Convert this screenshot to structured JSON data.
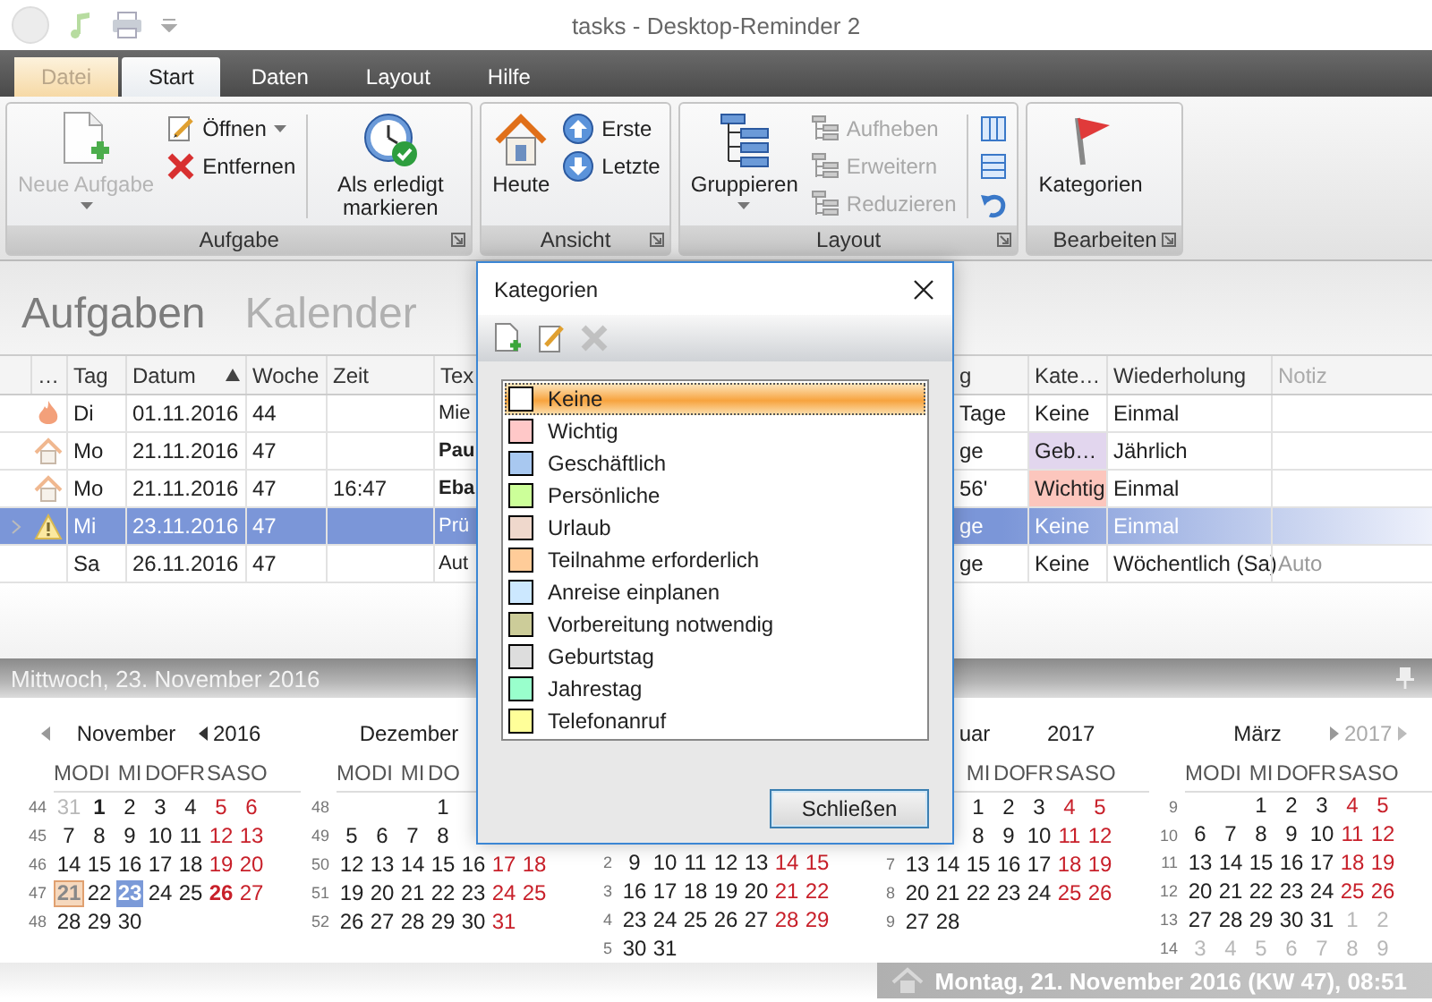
{
  "window": {
    "title": "tasks - Desktop-Reminder 2"
  },
  "ribbon_tabs": [
    {
      "label": "Datei",
      "kind": "file",
      "selected": false
    },
    {
      "label": "Start",
      "kind": "tab",
      "selected": true
    },
    {
      "label": "Daten",
      "kind": "tab",
      "selected": false
    },
    {
      "label": "Layout",
      "kind": "tab",
      "selected": false
    },
    {
      "label": "Hilfe",
      "kind": "tab",
      "selected": false
    }
  ],
  "ribbon": {
    "groups": [
      {
        "label": "Aufgabe",
        "items": [
          {
            "kind": "large",
            "label": "Neue Aufgabe",
            "disabled": true,
            "dropdown": true
          },
          {
            "kind": "small",
            "label": "Öffnen",
            "disabled": false,
            "dropdown": true
          },
          {
            "kind": "small",
            "label": "Entfernen",
            "disabled": false,
            "dropdown": false
          },
          {
            "kind": "large",
            "label": "Als erledigt markieren",
            "disabled": false,
            "dropdown": false
          }
        ]
      },
      {
        "label": "Ansicht",
        "items": [
          {
            "kind": "large",
            "label": "Heute",
            "disabled": false,
            "dropdown": false
          },
          {
            "kind": "small",
            "label": "Erste",
            "disabled": false,
            "dropdown": false
          },
          {
            "kind": "small",
            "label": "Letzte",
            "disabled": false,
            "dropdown": false
          }
        ]
      },
      {
        "label": "Layout",
        "items": [
          {
            "kind": "large",
            "label": "Gruppieren",
            "disabled": false,
            "dropdown": true
          },
          {
            "kind": "small",
            "label": "Aufheben",
            "disabled": true,
            "dropdown": false
          },
          {
            "kind": "small",
            "label": "Erweitern",
            "disabled": true,
            "dropdown": false
          },
          {
            "kind": "small",
            "label": "Reduzieren",
            "disabled": true,
            "dropdown": false
          },
          {
            "kind": "icon",
            "disabled": false,
            "dropdown": false
          },
          {
            "kind": "icon",
            "disabled": false,
            "dropdown": false
          },
          {
            "kind": "icon",
            "disabled": false,
            "dropdown": false
          }
        ]
      },
      {
        "label": "Bearbeiten",
        "items": [
          {
            "kind": "large",
            "label": "Kategorien",
            "disabled": false,
            "dropdown": false
          }
        ]
      }
    ]
  },
  "views": [
    {
      "label": "Aufgaben",
      "selected": true
    },
    {
      "label": "Kalender",
      "selected": false
    }
  ],
  "table": {
    "icon_header": "…",
    "columns": [
      {
        "label": "Tag"
      },
      {
        "label": "Datum",
        "sorted": true
      },
      {
        "label": "Woche"
      },
      {
        "label": "Zeit"
      },
      {
        "label": "Tex"
      },
      {
        "label": "g"
      },
      {
        "label": "Kate…"
      },
      {
        "label": "Wiederholung"
      },
      {
        "label": "Notiz"
      }
    ],
    "rows": [
      {
        "kind": "overdue",
        "selected": false,
        "text_bold": false,
        "color": "#ffffff",
        "cells": [
          "Di",
          "01.11.2016",
          "44",
          "",
          "Mie",
          "Tage",
          "Keine",
          "Einmal",
          ""
        ]
      },
      {
        "kind": "private",
        "selected": false,
        "text_bold": true,
        "color": "#e2d6ee",
        "cells": [
          "Mo",
          "21.11.2016",
          "47",
          "",
          "Pau",
          "ge",
          "Geb…",
          "Jährlich",
          ""
        ]
      },
      {
        "kind": "private",
        "selected": false,
        "text_bold": true,
        "color": "#fcc6bd",
        "cells": [
          "Mo",
          "21.11.2016",
          "47",
          "16:47",
          "Eba",
          "56'",
          "Wichtig",
          "Einmal",
          ""
        ]
      },
      {
        "kind": "warning",
        "selected": true,
        "text_bold": false,
        "cells": [
          "Mi",
          "23.11.2016",
          "47",
          "",
          "Prü",
          "ge",
          "Keine",
          "Einmal",
          ""
        ]
      },
      {
        "kind": "plain",
        "selected": false,
        "text_bold": false,
        "color": "#ffffff",
        "cells": [
          "Sa",
          "26.11.2016",
          "47",
          "",
          "Aut",
          "ge",
          "Keine",
          "Wöchentlich (Sa)",
          "Auto"
        ]
      }
    ]
  },
  "date_bar": {
    "text": "Mittwoch, 23. November 2016"
  },
  "calendar": {
    "months": [
      {
        "name": "November",
        "year": "2016",
        "weekdays": {
          "mon": "MO",
          "tue": "DI",
          "wed": "MI",
          "thu": "DO",
          "fri": "FR",
          "sat": "SA",
          "sun": "SO"
        },
        "weeks": [
          {
            "kind": "week",
            "number": "44",
            "days": {
              "mon": {
                "day": "31",
                "kind": "other"
              },
              "tue": {
                "day": "1",
                "kind": "bold"
              },
              "wed": "2",
              "thu": "3",
              "fri": "4",
              "sat": "5",
              "sun": "6"
            }
          },
          {
            "kind": "week",
            "number": "45",
            "days": {
              "mon": "7",
              "tue": "8",
              "wed": "9",
              "thu": "10",
              "fri": "11",
              "sat": "12",
              "sun": "13"
            }
          },
          {
            "kind": "week",
            "number": "46",
            "days": {
              "mon": "14",
              "tue": "15",
              "wed": "16",
              "thu": "17",
              "fri": "18",
              "sat": "19",
              "sun": "20"
            }
          },
          {
            "kind": "week",
            "number": "47",
            "days": {
              "mon": {
                "day": "21",
                "kind": "today"
              },
              "tue": "22",
              "wed": {
                "day": "23",
                "kind": "selected"
              },
              "thu": "24",
              "fri": "25",
              "sat": {
                "day": "26",
                "kind": "bold"
              },
              "sun": "27"
            }
          },
          {
            "kind": "week",
            "number": "48",
            "days": {
              "mon": "28",
              "tue": "29",
              "wed": "30"
            }
          }
        ]
      },
      {
        "name": "Dezember",
        "weekdays": {
          "mon": "MO",
          "tue": "DI",
          "wed": "MI",
          "thu": "DO"
        },
        "weeks": [
          {
            "kind": "week",
            "number": "48",
            "days": {
              "thu": "1"
            }
          },
          {
            "kind": "week",
            "number": "49",
            "days": {
              "mon": "5",
              "tue": "6",
              "wed": "7",
              "thu": "8"
            }
          },
          {
            "kind": "week",
            "number": "50",
            "days": {
              "mon": "12",
              "tue": "13",
              "wed": "14",
              "thu": "15",
              "fri": "16",
              "sat": "17",
              "sun": "18"
            }
          },
          {
            "kind": "week",
            "number": "51",
            "days": {
              "mon": "19",
              "tue": "20",
              "wed": "21",
              "thu": "22",
              "fri": "23",
              "sat": "24",
              "sun": "25"
            }
          },
          {
            "kind": "week",
            "number": "52",
            "days": {
              "mon": "26",
              "tue": "27",
              "wed": "28",
              "thu": "29",
              "fri": "30",
              "sat": "31"
            }
          }
        ]
      },
      {
        "weeks": [
          {
            "kind": "covered"
          },
          {
            "kind": "covered"
          },
          {
            "kind": "week",
            "number": "2",
            "days": {
              "mon": "9",
              "tue": "10",
              "wed": "11",
              "thu": "12",
              "fri": "13",
              "sat": "14",
              "sun": "15"
            }
          },
          {
            "kind": "week",
            "number": "3",
            "days": {
              "mon": "16",
              "tue": "17",
              "wed": "18",
              "thu": "19",
              "fri": "20",
              "sat": "21",
              "sun": "22"
            }
          },
          {
            "kind": "week",
            "number": "4",
            "days": {
              "mon": "23",
              "tue": "24",
              "wed": "25",
              "thu": "26",
              "fri": "27",
              "sat": "28",
              "sun": "29"
            }
          },
          {
            "kind": "week",
            "number": "5",
            "days": {
              "mon": "30",
              "tue": "31"
            }
          }
        ]
      },
      {
        "name": "uar",
        "year": "2017",
        "weekdays": {
          "wed": "MI",
          "thu": "DO",
          "fri": "FR",
          "sat": "SA",
          "sun": "SO"
        },
        "weeks": [
          {
            "kind": "week",
            "days": {
              "wed": "1",
              "thu": "2",
              "fri": "3",
              "sat": "4",
              "sun": "5"
            }
          },
          {
            "kind": "week",
            "days": {
              "wed": "8",
              "thu": "9",
              "fri": "10",
              "sat": "11",
              "sun": "12"
            }
          },
          {
            "kind": "week",
            "number": "7",
            "days": {
              "mon": "13",
              "tue": "14",
              "wed": "15",
              "thu": "16",
              "fri": "17",
              "sat": "18",
              "sun": "19"
            }
          },
          {
            "kind": "week",
            "number": "8",
            "days": {
              "mon": "20",
              "tue": "21",
              "wed": "22",
              "thu": "23",
              "fri": "24",
              "sat": "25",
              "sun": "26"
            }
          },
          {
            "kind": "week",
            "number": "9",
            "days": {
              "mon": "27",
              "tue": "28"
            }
          }
        ]
      },
      {
        "name": "März",
        "year": "2017",
        "weekdays": {
          "mon": "MO",
          "tue": "DI",
          "wed": "MI",
          "thu": "DO",
          "fri": "FR",
          "sat": "SA",
          "sun": "SO"
        },
        "weeks": [
          {
            "kind": "week",
            "number": "9",
            "days": {
              "wed": "1",
              "thu": "2",
              "fri": "3",
              "sat": "4",
              "sun": "5"
            }
          },
          {
            "kind": "week",
            "number": "10",
            "days": {
              "mon": "6",
              "tue": "7",
              "wed": "8",
              "thu": "9",
              "fri": "10",
              "sat": "11",
              "sun": "12"
            }
          },
          {
            "kind": "week",
            "number": "11",
            "days": {
              "mon": "13",
              "tue": "14",
              "wed": "15",
              "thu": "16",
              "fri": "17",
              "sat": "18",
              "sun": "19"
            }
          },
          {
            "kind": "week",
            "number": "12",
            "days": {
              "mon": "20",
              "tue": "21",
              "wed": "22",
              "thu": "23",
              "fri": "24",
              "sat": "25",
              "sun": "26"
            }
          },
          {
            "kind": "week",
            "number": "13",
            "days": {
              "mon": "27",
              "tue": "28",
              "wed": "29",
              "thu": "30",
              "fri": "31",
              "sat": {
                "day": "1",
                "kind": "other"
              },
              "sun": {
                "day": "2",
                "kind": "other"
              }
            }
          },
          {
            "kind": "week",
            "number": "14",
            "days": {
              "mon": {
                "day": "3",
                "kind": "other"
              },
              "tue": {
                "day": "4",
                "kind": "other"
              },
              "wed": {
                "day": "5",
                "kind": "other"
              },
              "thu": {
                "day": "6",
                "kind": "other"
              },
              "fri": {
                "day": "7",
                "kind": "other"
              },
              "sat": {
                "day": "8",
                "kind": "other"
              },
              "sun": {
                "day": "9",
                "kind": "other"
              }
            }
          }
        ]
      }
    ]
  },
  "status": {
    "text": "Montag, 21. November 2016 (KW 47), 08:51"
  },
  "dialog": {
    "title": "Kategorien",
    "toolbar": [
      {
        "disabled": false
      },
      {
        "disabled": false
      },
      {
        "disabled": true
      }
    ],
    "items": [
      {
        "label": "Keine",
        "color": "#ffffff",
        "selected": true
      },
      {
        "label": "Wichtig",
        "color": "#ffc8c8",
        "selected": false
      },
      {
        "label": "Geschäftlich",
        "color": "#a8c8f0",
        "selected": false
      },
      {
        "label": "Persönliche",
        "color": "#ccff99",
        "selected": false
      },
      {
        "label": "Urlaub",
        "color": "#efd8cc",
        "selected": false
      },
      {
        "label": "Teilnahme erforderlich",
        "color": "#ffcc99",
        "selected": false
      },
      {
        "label": "Anreise einplanen",
        "color": "#cce8ff",
        "selected": false
      },
      {
        "label": "Vorbereitung notwendig",
        "color": "#cccc99",
        "selected": false
      },
      {
        "label": "Geburtstag",
        "color": "#dddddd",
        "selected": false
      },
      {
        "label": "Jahrestag",
        "color": "#99ffcc",
        "selected": false
      },
      {
        "label": "Telefonanruf",
        "color": "#ffff99",
        "selected": false
      }
    ],
    "button": "Schließen"
  }
}
